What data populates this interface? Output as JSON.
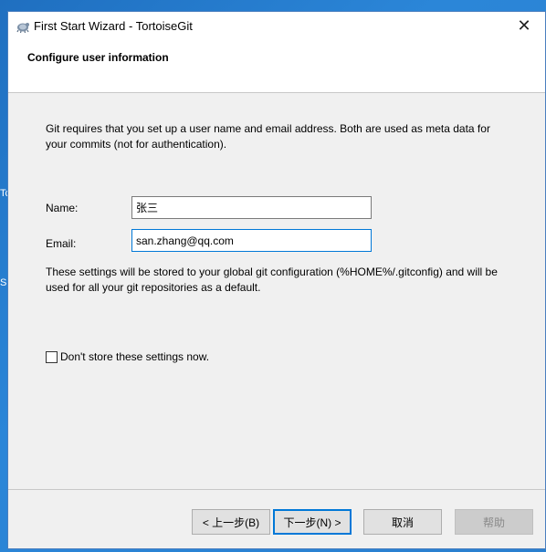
{
  "desktop": {
    "left_text_1": "Tc",
    "left_text_2": "S"
  },
  "window": {
    "title": "First Start Wizard - TortoiseGit",
    "close_glyph": "✕",
    "icon": "tortoisegit-icon"
  },
  "header": {
    "title": "Configure user information"
  },
  "intro_text": "Git requires that you set up a user name and email address. Both are used as meta data for your commits (not for authentication).",
  "fields": {
    "name_label": "Name:",
    "name_value": "张三",
    "email_label": "Email:",
    "email_value": "san.zhang@qq.com"
  },
  "note_text": "These settings will be stored to your global git configuration (%HOME%/.gitconfig) and will be used for all your git repositories as a default.",
  "checkbox": {
    "label": "Don't store these settings now.",
    "checked": false
  },
  "buttons": {
    "back": "< 上一步(B)",
    "next": "下一步(N) >",
    "cancel": "取消",
    "help": "帮助"
  }
}
